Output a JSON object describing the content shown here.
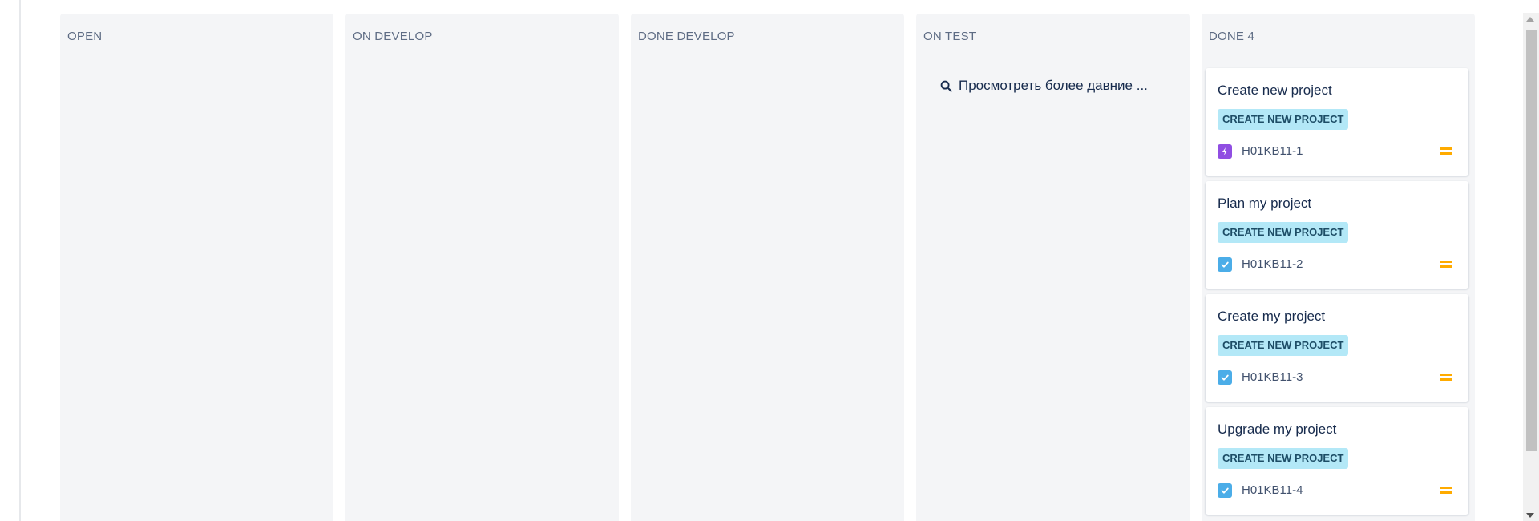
{
  "columns": [
    {
      "title": "OPEN"
    },
    {
      "title": "ON DEVELOP"
    },
    {
      "title": "DONE DEVELOP"
    },
    {
      "title": "ON TEST",
      "link": "Просмотреть более давние ..."
    },
    {
      "title": "DONE 4"
    }
  ],
  "cards": [
    {
      "title": "Create new project",
      "epic": "CREATE NEW PROJECT",
      "key": "H01KB11-1",
      "type_icon": "epic-lightning-icon",
      "type_color": "#904ee2",
      "priority_icon": "medium-priority-icon",
      "priority_color": "#ffab00"
    },
    {
      "title": "Plan my project",
      "epic": "CREATE NEW PROJECT",
      "key": "H01KB11-2",
      "type_icon": "task-checkbox-icon",
      "type_color": "#4bade8",
      "priority_icon": "medium-priority-icon",
      "priority_color": "#ffab00"
    },
    {
      "title": "Create my project",
      "epic": "CREATE NEW PROJECT",
      "key": "H01KB11-3",
      "type_icon": "task-checkbox-icon",
      "type_color": "#4bade8",
      "priority_icon": "medium-priority-icon",
      "priority_color": "#ffab00"
    },
    {
      "title": "Upgrade my project",
      "epic": "CREATE NEW PROJECT",
      "key": "H01KB11-4",
      "type_icon": "task-checkbox-icon",
      "type_color": "#4bade8",
      "priority_icon": "medium-priority-icon",
      "priority_color": "#ffab00"
    }
  ]
}
